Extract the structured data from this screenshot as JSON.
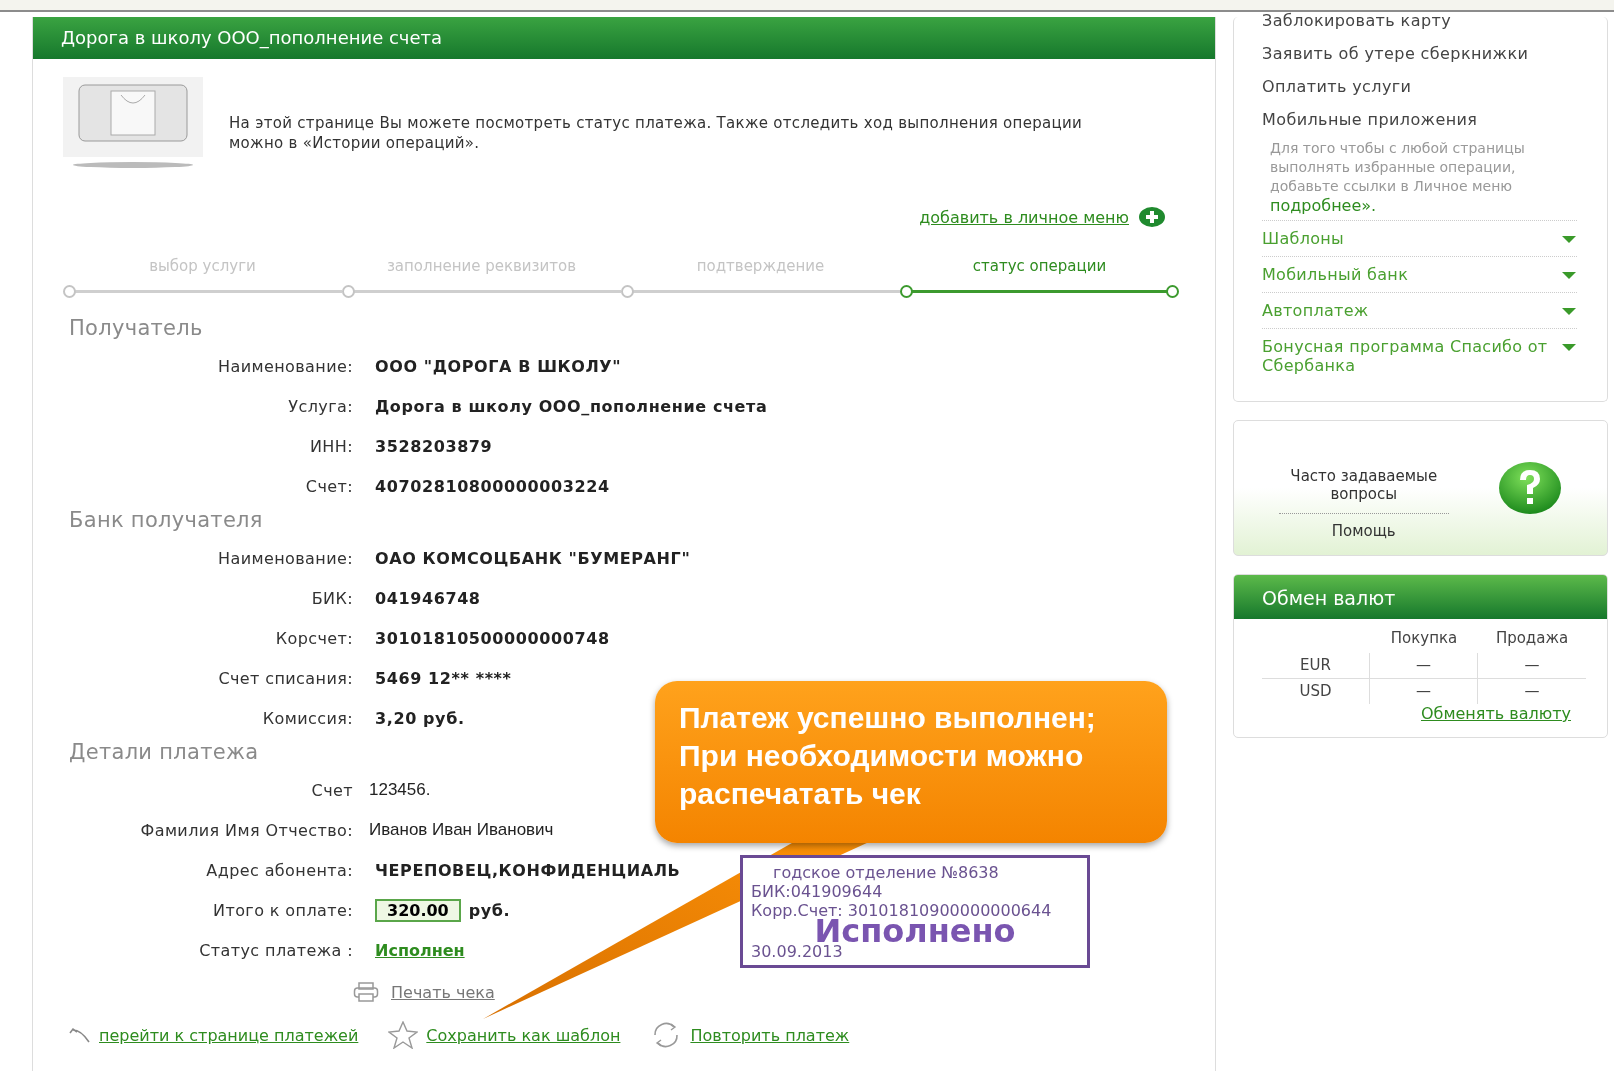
{
  "header": {
    "title": "Дорога в школу ООО_пополнение счета"
  },
  "intro": {
    "text": "На этой странице Вы можете посмотреть статус платежа. Также отследить ход выполнения операции можно в «Истории операций»."
  },
  "add_link": "добавить в личное меню",
  "steps": [
    {
      "label": "выбор услуги",
      "selected": false
    },
    {
      "label": "заполнение реквизитов",
      "selected": false
    },
    {
      "label": "подтверждение",
      "selected": false
    },
    {
      "label": "статус операции",
      "selected": true
    }
  ],
  "sections": [
    {
      "title": "Получатель",
      "rows": [
        {
          "label": "Наименование:",
          "value": "ООО \"ДОРОГА В ШКОЛУ\"",
          "kind": "bold"
        },
        {
          "label": "Услуга:",
          "value": "Дорога в школу ООО_пополнение счета",
          "kind": "bold"
        },
        {
          "label": "ИНН:",
          "value": "3528203879",
          "kind": "bold"
        },
        {
          "label": "Счет:",
          "value": "40702810800000003224",
          "kind": "bold"
        }
      ]
    },
    {
      "title": "Банк получателя",
      "rows": [
        {
          "label": "Наименование:",
          "value": "ОАО КОМСОЦБАНК \"БУМЕРАНГ\"",
          "kind": "bold"
        },
        {
          "label": "БИК:",
          "value": "041946748",
          "kind": "bold"
        },
        {
          "label": "Корсчет:",
          "value": "30101810500000000748",
          "kind": "bold"
        },
        {
          "label": "Счет списания:",
          "value": "5469 12** ****",
          "kind": "bold"
        },
        {
          "label": "Комиссия:",
          "value": "3,20 руб.",
          "kind": "bold"
        }
      ]
    },
    {
      "title": "Детали платежа",
      "rows": [
        {
          "label": "Счет",
          "value": "123456.",
          "kind": "plain"
        },
        {
          "label": "Фамилия Имя Отчество:",
          "value": "Иванов Иван Иванович",
          "kind": "plain"
        },
        {
          "label": "Адрес абонента:",
          "value": "ЧЕРЕПОВЕЦ,КОНФИДЕНЦИАЛЬ",
          "kind": "bold"
        },
        {
          "label": "Итого к оплате:",
          "value": "320.00",
          "unit": "руб.",
          "kind": "amount"
        },
        {
          "label": "Статус платежа :",
          "value": "Исполнен",
          "kind": "status"
        }
      ]
    }
  ],
  "print_link": "Печать чека",
  "bottom_links": [
    {
      "label": "перейти к странице платежей",
      "kind": "back"
    },
    {
      "label": "Сохранить как шаблон",
      "kind": "star"
    },
    {
      "label": "Повторить платеж",
      "kind": "repeat"
    }
  ],
  "stamp": {
    "lines": [
      "годское отделение №8638",
      "БИК:041909644",
      "Корр.Счет: 30101810900000000644"
    ],
    "mark": "Исполнено",
    "date": "30.09.2013"
  },
  "callout": {
    "lines": [
      "Платеж успешно выполнен;",
      "При необходимости можно",
      "распечатать чек"
    ]
  },
  "sidebar": {
    "menu": [
      "Заблокировать карту",
      "Заявить об утере сберкнижки",
      "Оплатить услуги",
      "Мобильные приложения"
    ],
    "note": "Для того чтобы с любой страницы выполнять избранные операции, добавьте ссылки в Личное меню",
    "more": "подробнее».",
    "sections": [
      {
        "label": "Шаблоны",
        "expanded": false
      },
      {
        "label": "Мобильный банк",
        "expanded": false
      },
      {
        "label": "Автоплатеж",
        "expanded": false
      },
      {
        "label": "Бонусная программа Спасибо от Сбербанка",
        "expanded": false
      }
    ]
  },
  "faq": {
    "title": "Часто задаваемые вопросы",
    "help": "Помощь"
  },
  "exchange": {
    "title": "Обмен валют",
    "columns": [
      "Покупка",
      "Продажа"
    ],
    "rows": [
      {
        "currency": "EUR",
        "buy": "—",
        "sell": "—"
      },
      {
        "currency": "USD",
        "buy": "—",
        "sell": "—"
      }
    ],
    "link": "Обменять валюту"
  }
}
